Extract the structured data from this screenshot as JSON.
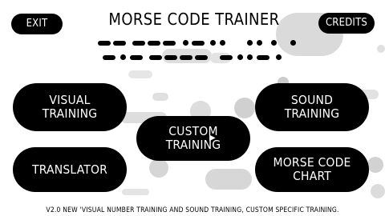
{
  "app": {
    "title": "MORSE CODE TRAINER"
  },
  "header": {
    "exit_label": "EXIT",
    "credits_label": "CREDITS"
  },
  "menu": {
    "visual_line1": "VISUAL",
    "visual_line2": "TRAINING",
    "sound_line1": "SOUND",
    "sound_line2": "TRAINING",
    "custom_line1": "CUSTOM",
    "custom_line2": "TRAINING",
    "translator_label": "TRANSLATOR",
    "chart_line1": "MORSE CODE",
    "chart_line2": "CHART"
  },
  "footer": {
    "version_text": "V2.0 NEW 'VISUAL NUMBER TRAINING AND SOUND TRAINING, CUSTOM SPECIFIC TRAINING."
  },
  "colors": {
    "button_bg": "#000000",
    "button_text": "#ffffff",
    "background": "#ffffff",
    "decor_gray": "#d9d9d9"
  }
}
